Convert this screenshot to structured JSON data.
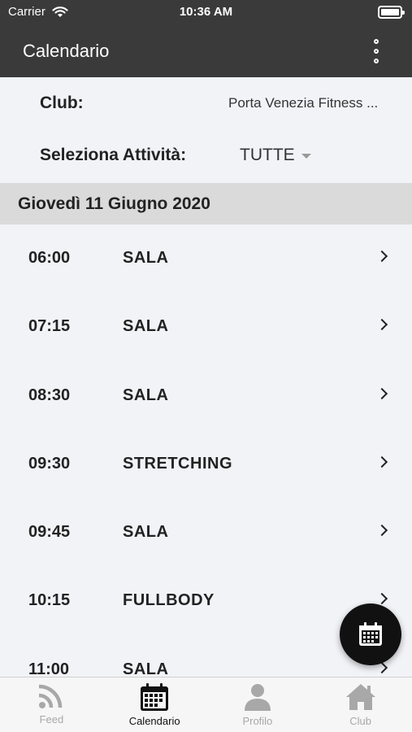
{
  "status_bar": {
    "carrier": "Carrier",
    "time": "10:36 AM"
  },
  "header": {
    "title": "Calendario"
  },
  "filters": {
    "club_label": "Club:",
    "club_value": "Porta Venezia Fitness ...",
    "activity_label": "Seleziona Attività:",
    "activity_value": "TUTTE"
  },
  "date": "Giovedì 11 Giugno 2020",
  "schedule": [
    {
      "time": "06:00",
      "activity": "SALA"
    },
    {
      "time": "07:15",
      "activity": "SALA"
    },
    {
      "time": "08:30",
      "activity": "SALA"
    },
    {
      "time": "09:30",
      "activity": "STRETCHING"
    },
    {
      "time": "09:45",
      "activity": "SALA"
    },
    {
      "time": "10:15",
      "activity": "FULLBODY"
    },
    {
      "time": "11:00",
      "activity": "SALA"
    }
  ],
  "tabs": [
    {
      "label": "Feed",
      "icon": "rss-icon",
      "active": false
    },
    {
      "label": "Calendario",
      "icon": "calendar-icon",
      "active": true
    },
    {
      "label": "Profilo",
      "icon": "person-icon",
      "active": false
    },
    {
      "label": "Club",
      "icon": "home-icon",
      "active": false
    }
  ],
  "colors": {
    "header_bg": "#3a3a3a",
    "date_bar_bg": "#dadada",
    "page_bg": "#f2f3f7",
    "fab_bg": "#111111"
  }
}
